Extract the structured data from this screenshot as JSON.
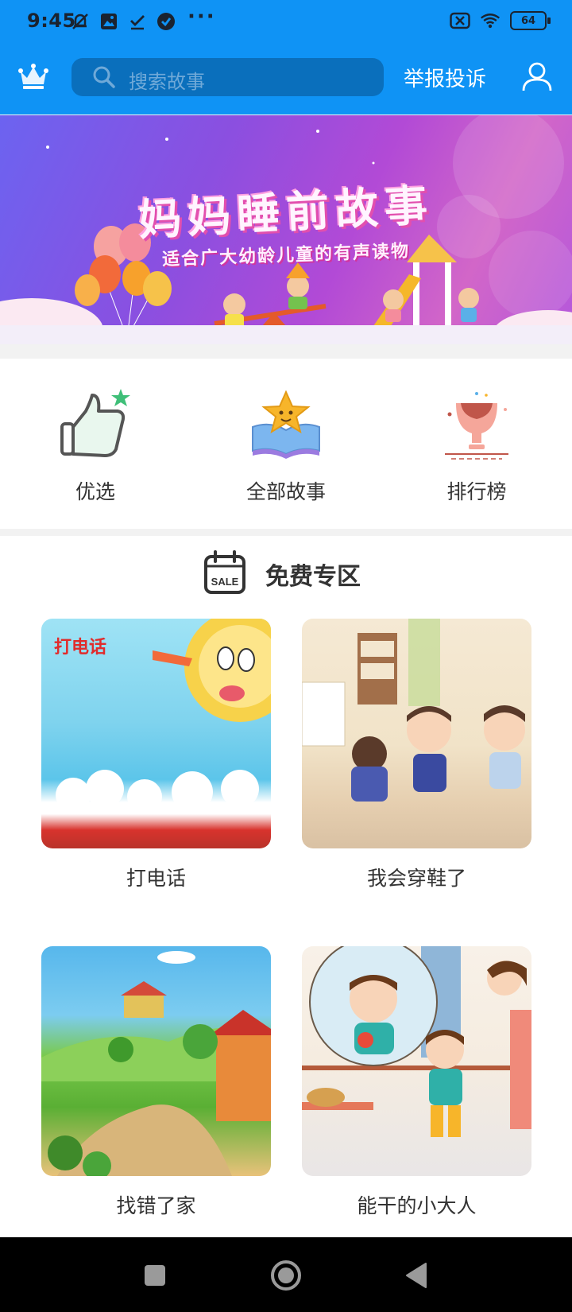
{
  "status_bar": {
    "time": "9:45",
    "battery": "64",
    "left_icons": [
      "muted-bell-icon",
      "gallery-icon",
      "check-icon",
      "verified-icon"
    ],
    "more": "···"
  },
  "toolbar": {
    "search_placeholder": "搜索故事",
    "report_label": "举报投诉"
  },
  "banner": {
    "title": "妈妈睡前故事",
    "subtitle": "适合广大幼龄儿童的有声读物"
  },
  "categories": [
    {
      "label": "优选",
      "icon": "thumbs-up-icon"
    },
    {
      "label": "全部故事",
      "icon": "book-star-icon"
    },
    {
      "label": "排行榜",
      "icon": "trophy-icon"
    }
  ],
  "free_zone": {
    "title": "免费专区",
    "calendar_badge": "SALE",
    "stories": [
      {
        "title": "打电话",
        "cover_text": "打电话"
      },
      {
        "title": "我会穿鞋了"
      },
      {
        "title": "找错了家"
      },
      {
        "title": "能干的小大人"
      }
    ]
  },
  "colors": {
    "header_blue": "#0f93f5",
    "search_bg": "#0a6fbc",
    "text_primary": "#333333"
  }
}
